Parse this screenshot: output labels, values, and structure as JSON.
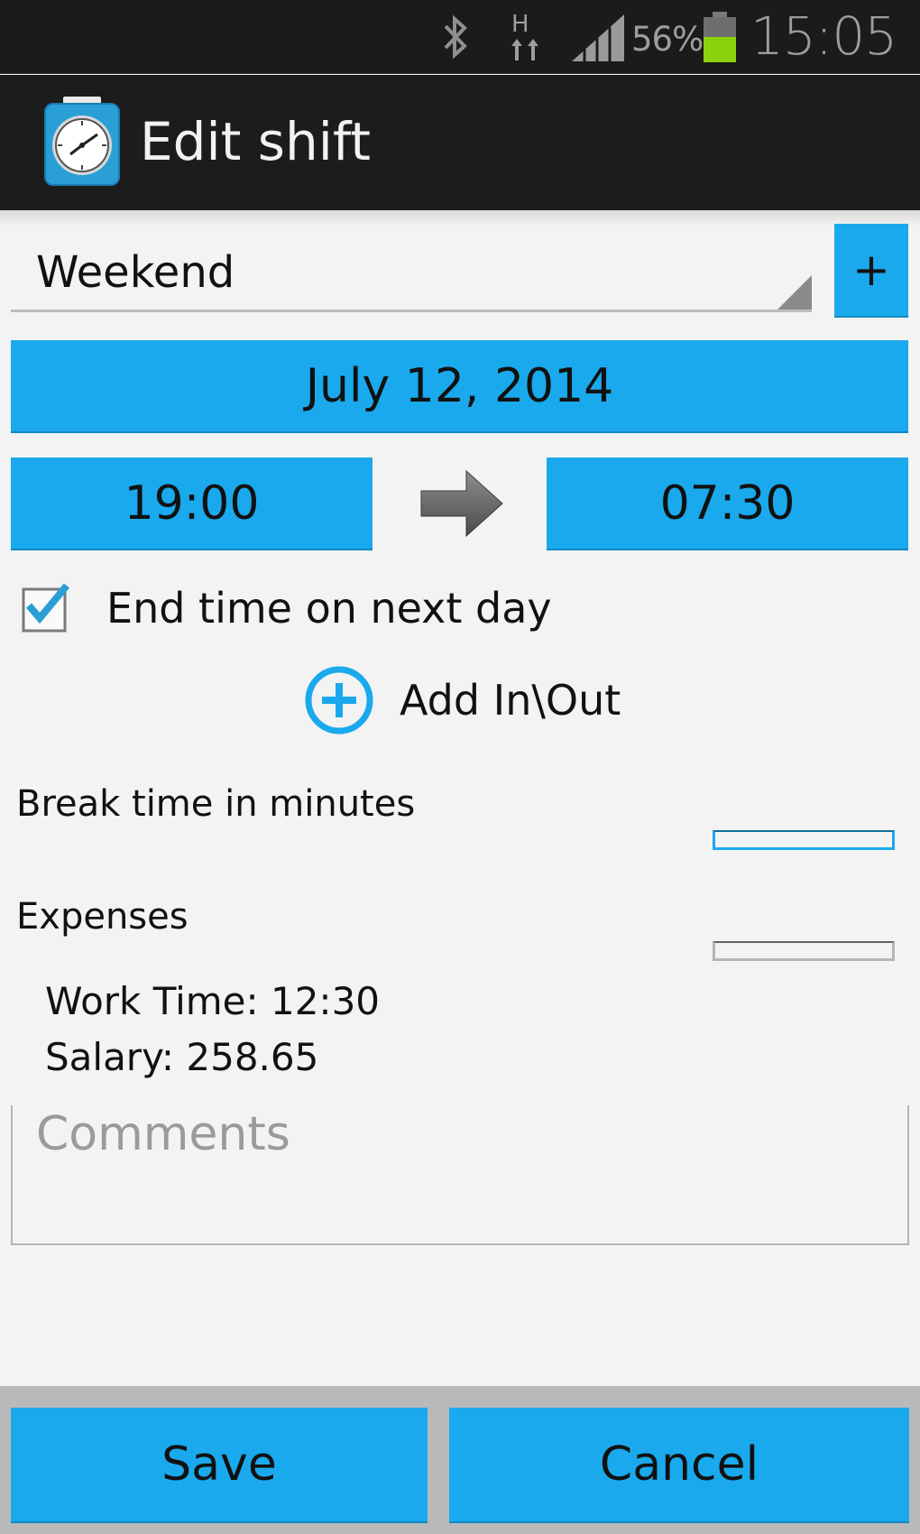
{
  "status_bar": {
    "battery_percent": "56%",
    "time": "15:05",
    "network_label": "H",
    "icons": [
      "bluetooth-icon",
      "network-h-icon",
      "signal-icon",
      "battery-icon"
    ],
    "battery_level": 0.56,
    "battery_color": "#8bd10c"
  },
  "action_bar": {
    "title": "Edit shift",
    "icon": "stopwatch-icon"
  },
  "form": {
    "shift_type": "Weekend",
    "add_type_label": "+",
    "date": "July 12, 2014",
    "start_time": "19:00",
    "end_time": "07:30",
    "next_day_label": "End time on next day",
    "next_day_checked": true,
    "add_inout_label": "Add In\\Out",
    "break_label": "Break time in minutes",
    "break_value": "",
    "expenses_label": "Expenses",
    "expenses_value": "",
    "work_time": "Work Time: 12:30",
    "salary": "Salary: 258.65",
    "comments_placeholder": "Comments"
  },
  "buttons": {
    "save": "Save",
    "cancel": "Cancel"
  },
  "colors": {
    "accent": "#1aa9ec",
    "action_bar": "#1c1c1c",
    "background": "#f3f3f3",
    "bottom_bar": "#b9b9b9"
  }
}
